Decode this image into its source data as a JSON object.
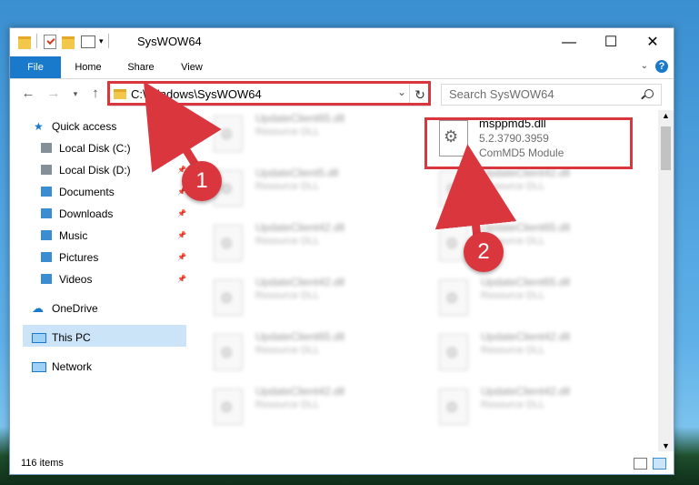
{
  "window": {
    "title": "SysWOW64"
  },
  "ribbon": {
    "file": "File",
    "home": "Home",
    "share": "Share",
    "view": "View"
  },
  "address": {
    "path": "C:\\Windows\\SysWOW64"
  },
  "search": {
    "placeholder": "Search SysWOW64"
  },
  "nav": {
    "quick_access": "Quick access",
    "items": [
      {
        "label": "Local Disk (C:)",
        "icon": "drive-icon"
      },
      {
        "label": "Local Disk (D:)",
        "icon": "drive-icon"
      },
      {
        "label": "Documents",
        "icon": "documents-icon"
      },
      {
        "label": "Downloads",
        "icon": "downloads-icon"
      },
      {
        "label": "Music",
        "icon": "music-icon"
      },
      {
        "label": "Pictures",
        "icon": "pictures-icon"
      },
      {
        "label": "Videos",
        "icon": "videos-icon"
      }
    ],
    "onedrive": "OneDrive",
    "thispc": "This PC",
    "network": "Network"
  },
  "files": {
    "main": {
      "name": "msppmd5.dll",
      "version": "5.2.3790.3959",
      "desc": "ComMD5 Module"
    },
    "blurred": [
      {
        "name": "UpdateClient65.dll",
        "type": "Resource DLL"
      },
      {
        "name": "UpdateClient5.dll",
        "type": "Resource DLL"
      },
      {
        "name": "UpdateClient42.dll",
        "type": "Resource DLL"
      },
      {
        "name": "UpdateClient42.dll",
        "type": "Resource DLL"
      },
      {
        "name": "UpdateClient65.dll",
        "type": "Resource DLL"
      },
      {
        "name": "UpdateClient42.dll",
        "type": "Resource DLL"
      },
      {
        "name": "UpdateClient65.dll",
        "type": "Resource DLL"
      },
      {
        "name": "UpdateClient65.dll",
        "type": "Resource DLL"
      },
      {
        "name": "UpdateClient42.dll",
        "type": "Resource DLL"
      },
      {
        "name": "UpdateClient42.dll",
        "type": "Resource DLL"
      },
      {
        "name": "UpdateClient42.dll",
        "type": "Resource DLL"
      }
    ]
  },
  "status": {
    "count": "116 items"
  },
  "annotations": {
    "step1": "1",
    "step2": "2"
  },
  "colors": {
    "accent": "#1979ca",
    "highlight": "#d9363e",
    "selection": "#cce4f7"
  }
}
